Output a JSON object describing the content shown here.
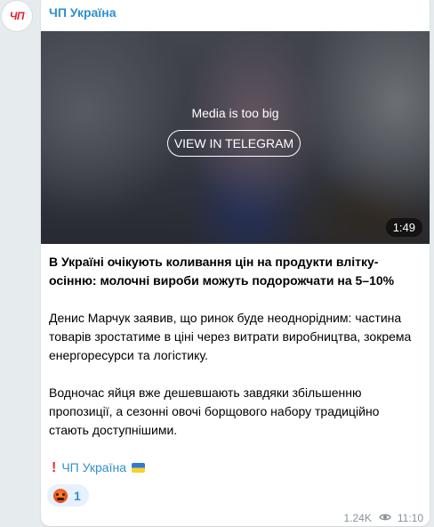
{
  "channel": {
    "avatar_text": "ЧП",
    "name": "ЧП Україна"
  },
  "media": {
    "notice": "Media is too big",
    "button_label": "VIEW IN TELEGRAM",
    "duration": "1:49"
  },
  "post": {
    "title": "В Україні очікують коливання цін на продукти влітку-осінню: молочні вироби можуть подорожчати на 5–10%",
    "paragraph_1": "Денис Марчук заявив, що ринок буде неоднорідним: частина товарів зростатиме в ціні через витрати виробництва, зокрема енергоресурси та логістику.",
    "paragraph_2": "Водночас яйця вже дешевшають завдяки збільшенню пропозиції, а сезонні овочі борщового набору традиційно стають доступнішими.",
    "signature_link": "ЧП Україна",
    "signature_icon": "exclamation-icon",
    "flag_icon": "ukraine-flag-icon"
  },
  "reaction": {
    "emoji_icon": "angry-face-icon",
    "count": "1"
  },
  "footer": {
    "views": "1.24K",
    "time": "11:10",
    "views_icon": "eye-icon"
  },
  "colors": {
    "accent": "#2f8fd0",
    "brand_red": "#e5202c",
    "background": "#e6ebee"
  }
}
